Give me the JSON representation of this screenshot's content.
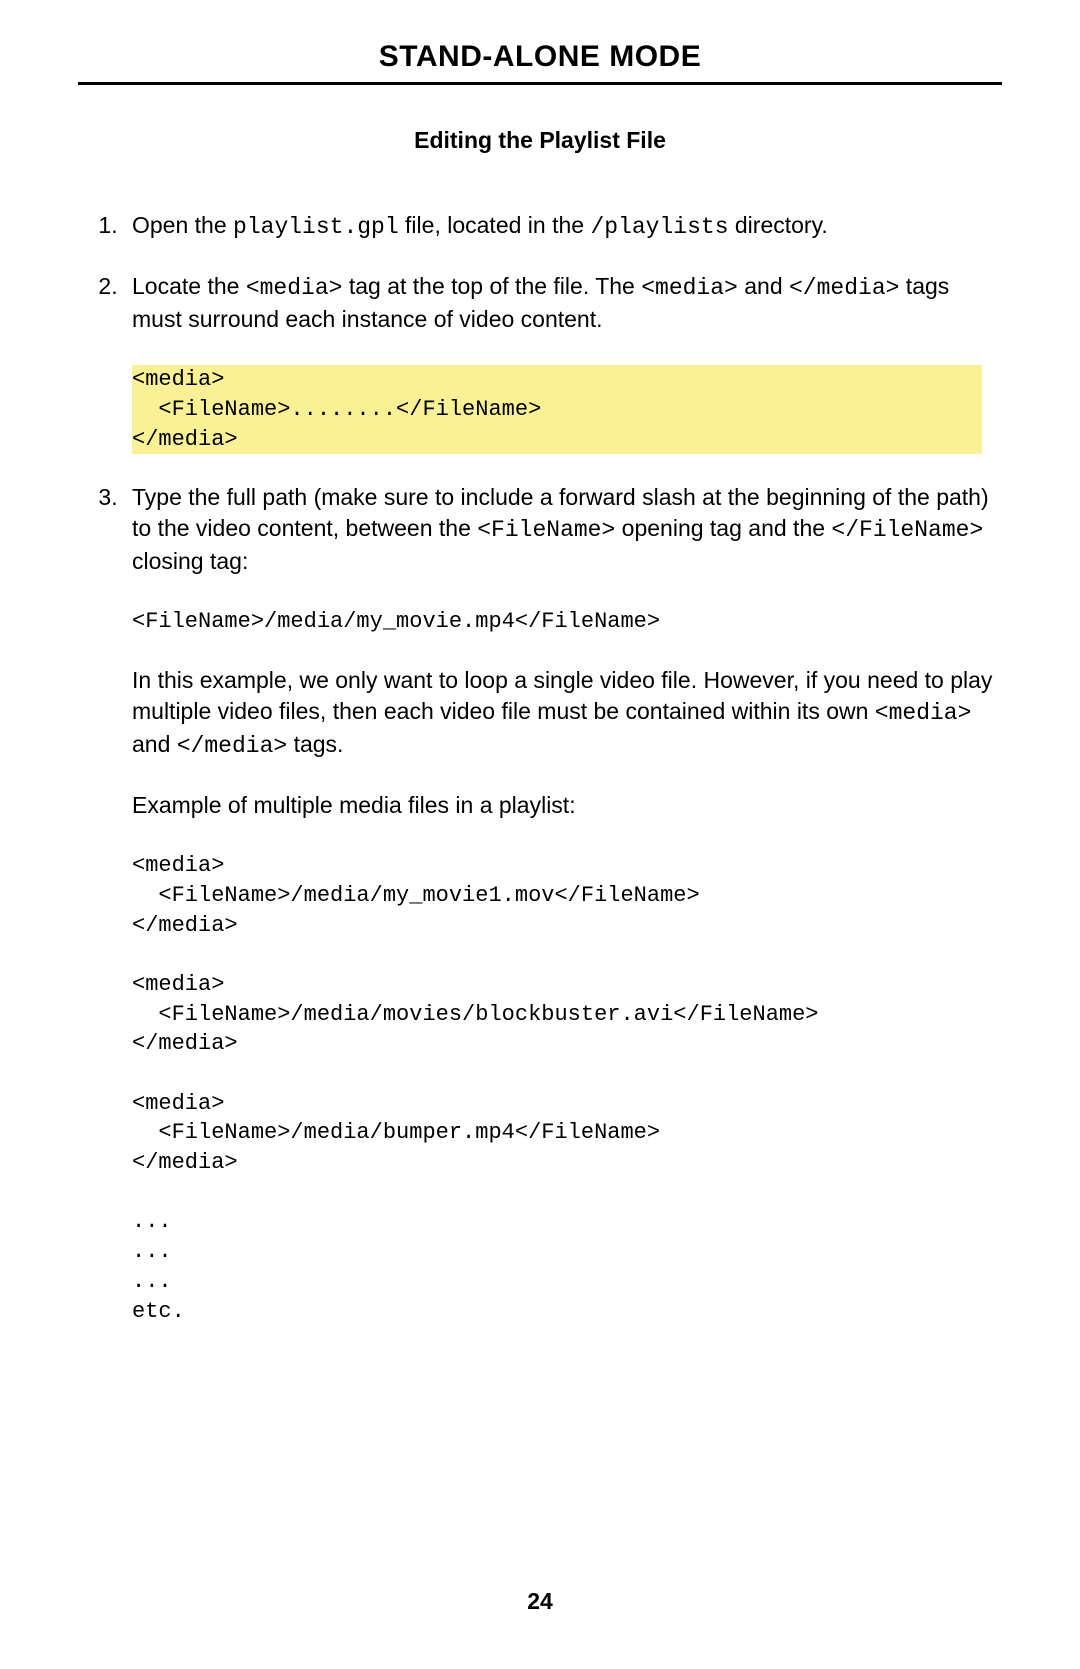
{
  "header": {
    "title": "STAND-ALONE MODE"
  },
  "subtitle": "Editing the Playlist File",
  "step1": {
    "t1": "Open the ",
    "c1": "playlist.gpl",
    "t2": " ﬁle, located in the ",
    "c2": "/playlists",
    "t3": " directory."
  },
  "step2": {
    "t1": "Locate the ",
    "c1": "<media>",
    "t2": " tag at the top of the ﬁle.  The ",
    "c2": "<media>",
    "t3": " and ",
    "c3": "</media>",
    "t4": " tags must surround each instance of video content.",
    "code1": "<media>",
    "code2": "  <FileName>........</FileName>",
    "code3": "</media>"
  },
  "step3": {
    "t1": "Type the full path (make sure to include a forward slash at the beginning of the path) to the video content, between the ",
    "c1": "<FileName>",
    "t2": " opening tag and the ",
    "c2": "</FileName>",
    "t3": " closing tag:",
    "example1": "<FileName>/media/my_movie.mp4</FileName>",
    "p2a": "In this example, we only want to loop a single video ﬁle.  However, if you need to play multiple video ﬁles, then each video ﬁle must be contained within its own ",
    "c3": "<media>",
    "p2b": " and ",
    "c4": "</media>",
    "p2c": " tags.",
    "p3": "Example of multiple media ﬁles in a playlist:",
    "example2": "<media>\n  <FileName>/media/my_movie1.mov</FileName>\n</media>\n\n<media>\n  <FileName>/media/movies/blockbuster.avi</FileName>\n</media>\n\n<media>\n  <FileName>/media/bumper.mp4</FileName>\n</media>\n\n...\n...\n...\netc."
  },
  "page_number": "24"
}
